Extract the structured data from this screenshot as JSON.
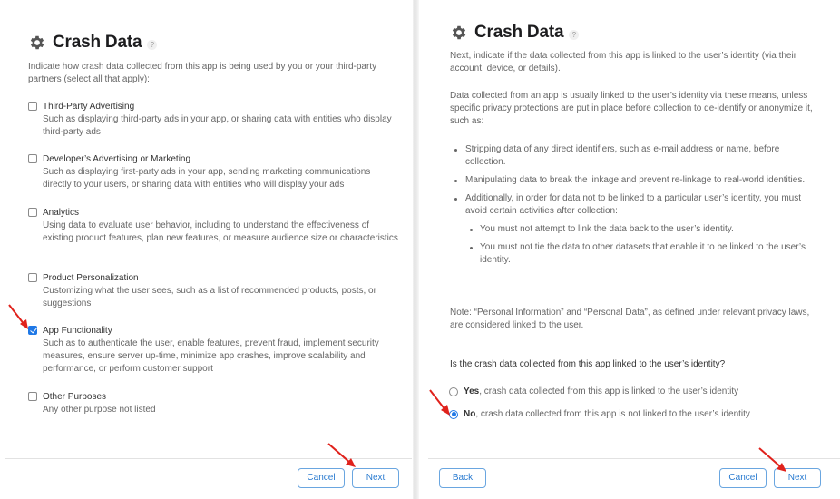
{
  "left": {
    "title": "Crash Data",
    "help_glyph": "?",
    "intro": "Indicate how crash data collected from this app is being used by you or your third-party partners (select all that apply):",
    "options": [
      {
        "label": "Third-Party Advertising",
        "description": "Such as displaying third-party ads in your app, or sharing data with entities who display third-party ads",
        "checked": false
      },
      {
        "label": "Developer’s Advertising or Marketing",
        "description": "Such as displaying first-party ads in your app, sending marketing communications directly to your users, or sharing data with entities who will display your ads",
        "checked": false
      },
      {
        "label": "Analytics",
        "description": "Using data to evaluate user behavior, including to understand the effectiveness of existing product features, plan new features, or measure audience size or characteristics",
        "checked": false
      },
      {
        "label": "Product Personalization",
        "description": "Customizing what the user sees, such as a list of recommended products, posts, or suggestions",
        "checked": false
      },
      {
        "label": "App Functionality",
        "description": "Such as to authenticate the user, enable features, prevent fraud, implement security measures, ensure server up-time, minimize app crashes, improve scalability and performance, or perform customer support",
        "checked": true
      },
      {
        "label": "Other Purposes",
        "description": "Any other purpose not listed",
        "checked": false
      }
    ],
    "cancel_label": "Cancel",
    "next_label": "Next"
  },
  "right": {
    "title": "Crash Data",
    "help_glyph": "?",
    "intro": "Next, indicate if the data collected from this app is linked to the user’s identity (via their account, device, or details).",
    "para": "Data collected from an app is usually linked to the user’s identity via these means, unless specific privacy protections are put in place before collection to de-identify or anonymize it, such as:",
    "bullets": [
      "Stripping data of any direct identifiers, such as e-mail address or name, before collection.",
      "Manipulating data to break the linkage and prevent re-linkage to real-world identities.",
      "Additionally, in order for data not to be linked to a particular user’s identity, you must avoid certain activities after collection:"
    ],
    "sub_bullets": [
      "You must not attempt to link the data back to the user’s identity.",
      "You must not tie the data to other datasets that enable it to be linked to the user’s identity."
    ],
    "note": "Note: “Personal Information” and “Personal Data”, as defined under relevant privacy laws, are considered linked to the user.",
    "question": "Is the crash data collected from this app linked to the user’s identity?",
    "radios": [
      {
        "strong": "Yes",
        "rest": ", crash data collected from this app is linked to the user’s identity",
        "checked": false
      },
      {
        "strong": "No",
        "rest": ", crash data collected from this app is not linked to the user’s identity",
        "checked": true
      }
    ],
    "back_label": "Back",
    "cancel_label": "Cancel",
    "next_label": "Next"
  },
  "colors": {
    "accent": "#1f78e6",
    "button_text": "#2a7bd0",
    "annotation_arrow": "#e0221c"
  }
}
